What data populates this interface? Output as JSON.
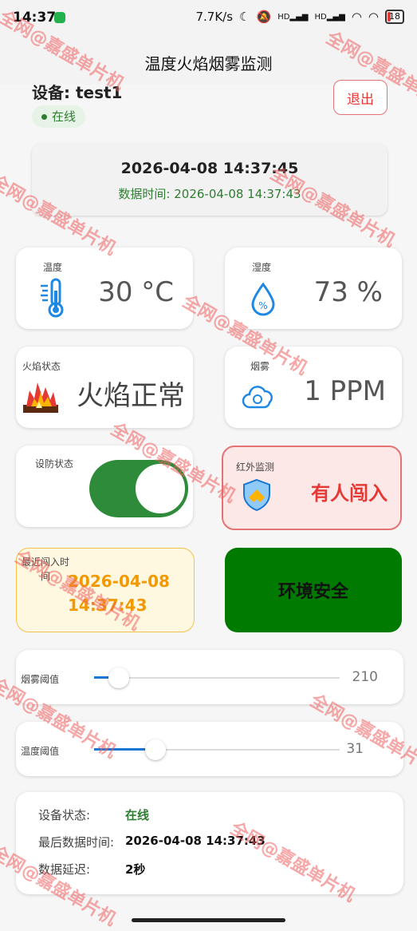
{
  "status_bar": {
    "time": "14:37",
    "network_speed": "7.7K/s",
    "signal1": "HD",
    "signal2": "HD",
    "battery": "18",
    "battery_fraction": 0.18
  },
  "app_bar": {
    "title": "温度火焰烟雾监测"
  },
  "device": {
    "name": "设备: test1",
    "status": "在线",
    "logout_label": "退出"
  },
  "time_card": {
    "current_time": "2026-04-08 14:37:45",
    "data_time": "数据时间: 2026-04-08 14:37:43"
  },
  "temperature": {
    "label": "温度",
    "value": "30 °C",
    "icon": "thermometer-icon"
  },
  "humidity": {
    "label": "湿度",
    "value": "73 %",
    "icon": "water-drop-icon"
  },
  "flame": {
    "label": "火焰状态",
    "value": "火焰正常",
    "icon": "flame-icon"
  },
  "smoke": {
    "label": "烟雾",
    "value": "1 PPM",
    "icon": "cloud-icon"
  },
  "armed": {
    "label": "设防状态",
    "on": true
  },
  "infrared": {
    "label": "红外监测",
    "value": "有人闯入",
    "icon": "shield-alert-icon"
  },
  "last_intrusion": {
    "label": "最近闯入时间",
    "value_date": "2026-04-08",
    "value_time": "14:37:43"
  },
  "environment": {
    "value": "环境安全",
    "color": "#007a00"
  },
  "smoke_threshold": {
    "label": "烟雾阈值",
    "value": "210",
    "fraction": 0.1
  },
  "temp_threshold": {
    "label": "温度阈值",
    "value": "31",
    "fraction": 0.25
  },
  "summary": {
    "status_label": "设备状态:",
    "status_value": "在线",
    "last_label": "最后数据时间:",
    "last_value": "2026-04-08 14:37:43",
    "delay_label": "数据延迟:",
    "delay_value": "2秒"
  },
  "watermark": "全网@嘉盛单片机",
  "colors": {
    "online_green": "#2e7d32",
    "alert_red": "#e53935",
    "warn_orange": "#f29900",
    "slider_blue": "#1976d2"
  }
}
